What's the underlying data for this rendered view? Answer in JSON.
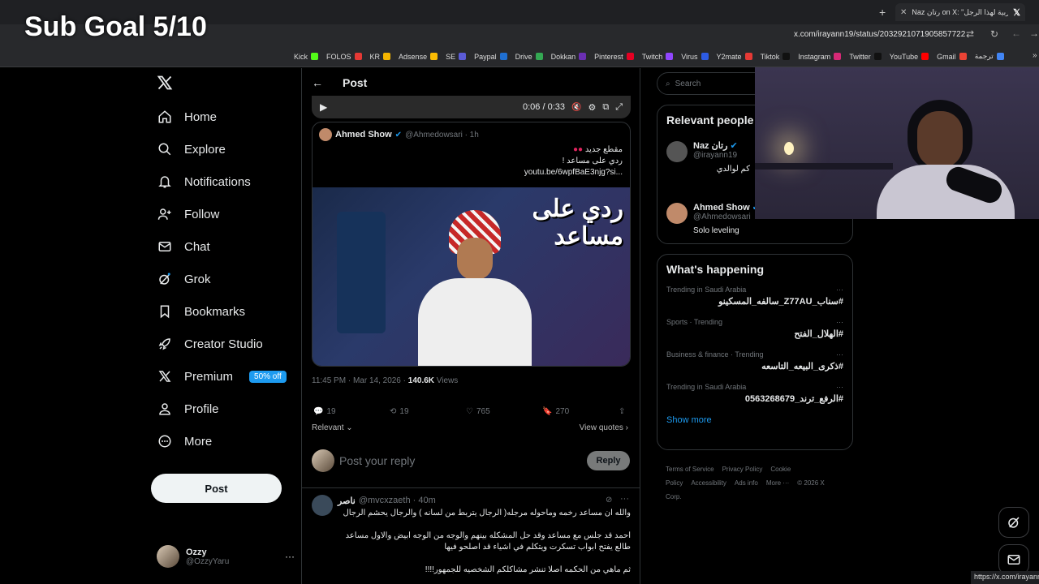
{
  "overlay": {
    "sub_goal": "Sub Goal 5/10"
  },
  "browser": {
    "tab_title": "Naz رتان on X: \"الحربية لهذا الرجل\"",
    "url": "x.com/irayann19/status/2032921071905857722",
    "bookmarks": [
      {
        "label": "Kick",
        "color": "#53fc18"
      },
      {
        "label": "FOLOS",
        "color": "#e53935"
      },
      {
        "label": "KR",
        "color": "#f4b400"
      },
      {
        "label": "Adsense",
        "color": "#fbbc04"
      },
      {
        "label": "SE",
        "color": "#5b5bd6"
      },
      {
        "label": "Paypal",
        "color": "#1f6fd1"
      },
      {
        "label": "Drive",
        "color": "#34a853"
      },
      {
        "label": "Dokkan",
        "color": "#6b2fb3"
      },
      {
        "label": "Pinterest",
        "color": "#e60023"
      },
      {
        "label": "Twitch",
        "color": "#9146ff"
      },
      {
        "label": "Virus",
        "color": "#2d5be3"
      },
      {
        "label": "Y2mate",
        "color": "#e53935"
      },
      {
        "label": "Tiktok",
        "color": "#111111"
      },
      {
        "label": "Instagram",
        "color": "#d62976"
      },
      {
        "label": "Twitter",
        "color": "#111111"
      },
      {
        "label": "YouTube",
        "color": "#ff0000"
      },
      {
        "label": "Gmail",
        "color": "#ea4335"
      },
      {
        "label": "ترجمة",
        "color": "#4285f4"
      }
    ],
    "status_url": "https://x.com/irayann"
  },
  "nav": {
    "items": [
      {
        "label": "Home",
        "icon": "home-icon"
      },
      {
        "label": "Explore",
        "icon": "search-icon"
      },
      {
        "label": "Notifications",
        "icon": "bell-icon"
      },
      {
        "label": "Follow",
        "icon": "person-add-icon"
      },
      {
        "label": "Chat",
        "icon": "mail-icon"
      },
      {
        "label": "Grok",
        "icon": "grok-icon"
      },
      {
        "label": "Bookmarks",
        "icon": "bookmark-icon"
      },
      {
        "label": "Creator Studio",
        "icon": "rocket-icon"
      },
      {
        "label": "Premium",
        "icon": "x-icon",
        "badge": "50% off"
      },
      {
        "label": "Profile",
        "icon": "person-icon"
      },
      {
        "label": "More",
        "icon": "more-icon"
      }
    ],
    "post_button": "Post",
    "account": {
      "name": "Ozzy",
      "handle": "@OzzyYaru"
    }
  },
  "main": {
    "header_title": "Post",
    "video": {
      "time": "0:06 / 0:33"
    },
    "quoted": {
      "name": "Ahmed Show",
      "handle": "@Ahmedowsari · 1h",
      "line1": "مقطع جديد",
      "line2": "ردي على مساعد !",
      "link": "youtu.be/6wpfBaE3njg?si..."
    },
    "thumb_text": "ردي على مساعد",
    "meta": {
      "time": "11:45 PM · Mar 14, 2026 ·",
      "views_num": "140.6K",
      "views_label": "Views"
    },
    "actions": {
      "replies": "19",
      "reposts": "19",
      "likes": "765",
      "bookmarks": "270"
    },
    "sort_label": "Relevant",
    "view_quotes": "View quotes",
    "reply_placeholder": "Post your reply",
    "reply_button": "Reply",
    "comment": {
      "name": "ناصر",
      "handle": "@mvcxzaeth · 40m",
      "p1": "والله ان مساعد رخمه وماحوله مرجله( الرجال يتربط من لسانه ) والرجال يحشم الرجال",
      "p2": "احمد قد جلس مع مساعد وقد حل المشكله بينهم والوجه من الوجه ابيض والاول مساعد",
      "p3": "طالع يفتح ابواب تسكرت ويتكلم في اشياء قد اصلحو فيها",
      "p4": "ثم ماهي من الحكمه اصلا تنشر مشاكلكم الشخصيه للجمهور!!!!"
    }
  },
  "right": {
    "search_placeholder": "Search",
    "relevant_title": "Relevant people",
    "people": [
      {
        "name": "Naz رتان",
        "handle": "@irayann19",
        "bio": "كم لوالدي"
      },
      {
        "name": "Ahmed Show",
        "handle": "@Ahmedowsari",
        "bio": "Solo leveling"
      }
    ],
    "happening_title": "What's happening",
    "trends": [
      {
        "context": "Trending in Saudi Arabia",
        "tag": "#سناب_Z77AU_سالفه_المسكينو"
      },
      {
        "context": "Sports · Trending",
        "tag": "#الهلال_الفتح"
      },
      {
        "context": "Business & finance · Trending",
        "tag": "#ذكرى_البيعه_التاسعه"
      },
      {
        "context": "Trending in Saudi Arabia",
        "tag": "#الرفع_ترند_0563268679"
      }
    ],
    "show_more": "Show more",
    "footer": [
      "Terms of Service",
      "Privacy Policy",
      "Cookie Policy",
      "Accessibility",
      "Ads info",
      "More ···",
      "© 2026 X Corp."
    ]
  },
  "colors": {
    "accent": "#1d9bf0",
    "background": "#000000",
    "border": "#2f3336",
    "muted": "#71767b"
  }
}
